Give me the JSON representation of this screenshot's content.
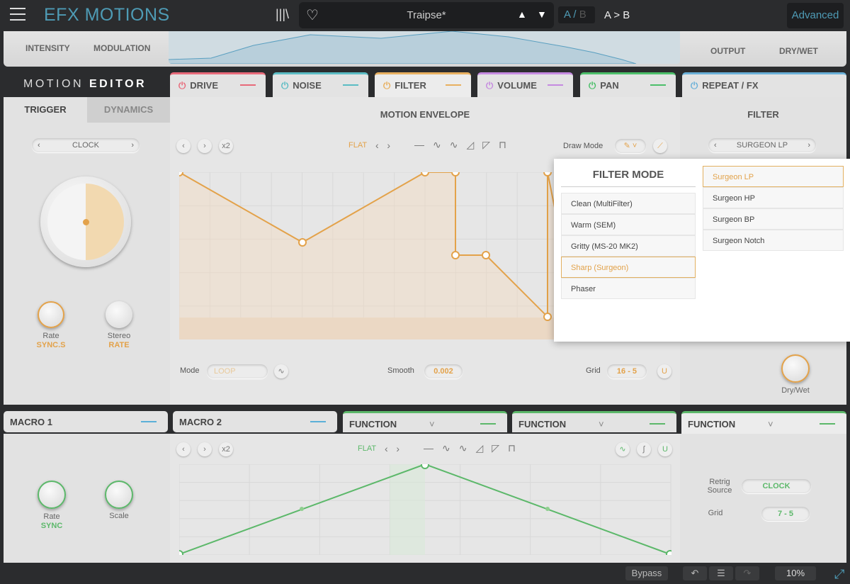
{
  "header": {
    "app_title": "EFX MOTIONS",
    "preset_name": "Traipse*",
    "ab_a": "A",
    "ab_sep": "/",
    "ab_b": "B",
    "copy_ab": "A > B",
    "advanced": "Advanced",
    "prev": "▲",
    "next": "▼"
  },
  "upper": {
    "intensity": "INTENSITY",
    "modulation": "MODULATION",
    "output": "OUTPUT",
    "drywet": "DRY/WET"
  },
  "motion_editor": {
    "title_light": "MOTION",
    "title_bold": "EDITOR",
    "tabs": [
      {
        "label": "DRIVE",
        "color": "#e86a7a"
      },
      {
        "label": "NOISE",
        "color": "#5bbcc4"
      },
      {
        "label": "FILTER",
        "color": "#e8b060"
      },
      {
        "label": "VOLUME",
        "color": "#c58ae0"
      },
      {
        "label": "PAN",
        "color": "#4cbf6a"
      },
      {
        "label": "REPEAT / FX",
        "color": "#6ab0d8"
      }
    ]
  },
  "trigger": {
    "tab_trigger": "TRIGGER",
    "tab_dynamics": "DYNAMICS",
    "source": "CLOCK",
    "rate_label": "Rate",
    "rate_value": "SYNC.S",
    "stereo_label": "Stereo",
    "stereo_value": "RATE"
  },
  "envelope": {
    "title": "MOTION ENVELOPE",
    "x2": "x2",
    "flat": "FLAT",
    "draw_mode": "Draw Mode",
    "mode_label": "Mode",
    "mode_value": "LOOP",
    "smooth_label": "Smooth",
    "smooth_value": "0.002",
    "grid_label": "Grid",
    "grid_value": "16 - 5"
  },
  "filter": {
    "title": "FILTER",
    "type": "SURGEON LP",
    "drywet": "Dry/Wet"
  },
  "filter_popup": {
    "title": "FILTER MODE",
    "modes": [
      "Clean (MultiFilter)",
      "Warm (SEM)",
      "Gritty (MS-20 MK2)",
      "Sharp (Surgeon)",
      "Phaser"
    ],
    "selected_mode": "Sharp (Surgeon)",
    "types": [
      "Surgeon LP",
      "Surgeon HP",
      "Surgeon BP",
      "Surgeon Notch"
    ],
    "selected_type": "Surgeon LP"
  },
  "macros": {
    "tabs": [
      "MACRO 1",
      "MACRO 2",
      "FUNCTION",
      "FUNCTION",
      "FUNCTION"
    ],
    "x2": "x2",
    "flat": "FLAT",
    "rate_label": "Rate",
    "rate_value": "SYNC",
    "scale_label": "Scale",
    "retrig_label": "Retrig Source",
    "retrig_value": "CLOCK",
    "grid_label": "Grid",
    "grid_value": "7 - 5"
  },
  "footer": {
    "bypass": "Bypass",
    "zoom": "10%"
  },
  "colors": {
    "accent_filter": "#e8a84a",
    "accent_function": "#5cb86a",
    "brand": "#4e9bb5"
  }
}
